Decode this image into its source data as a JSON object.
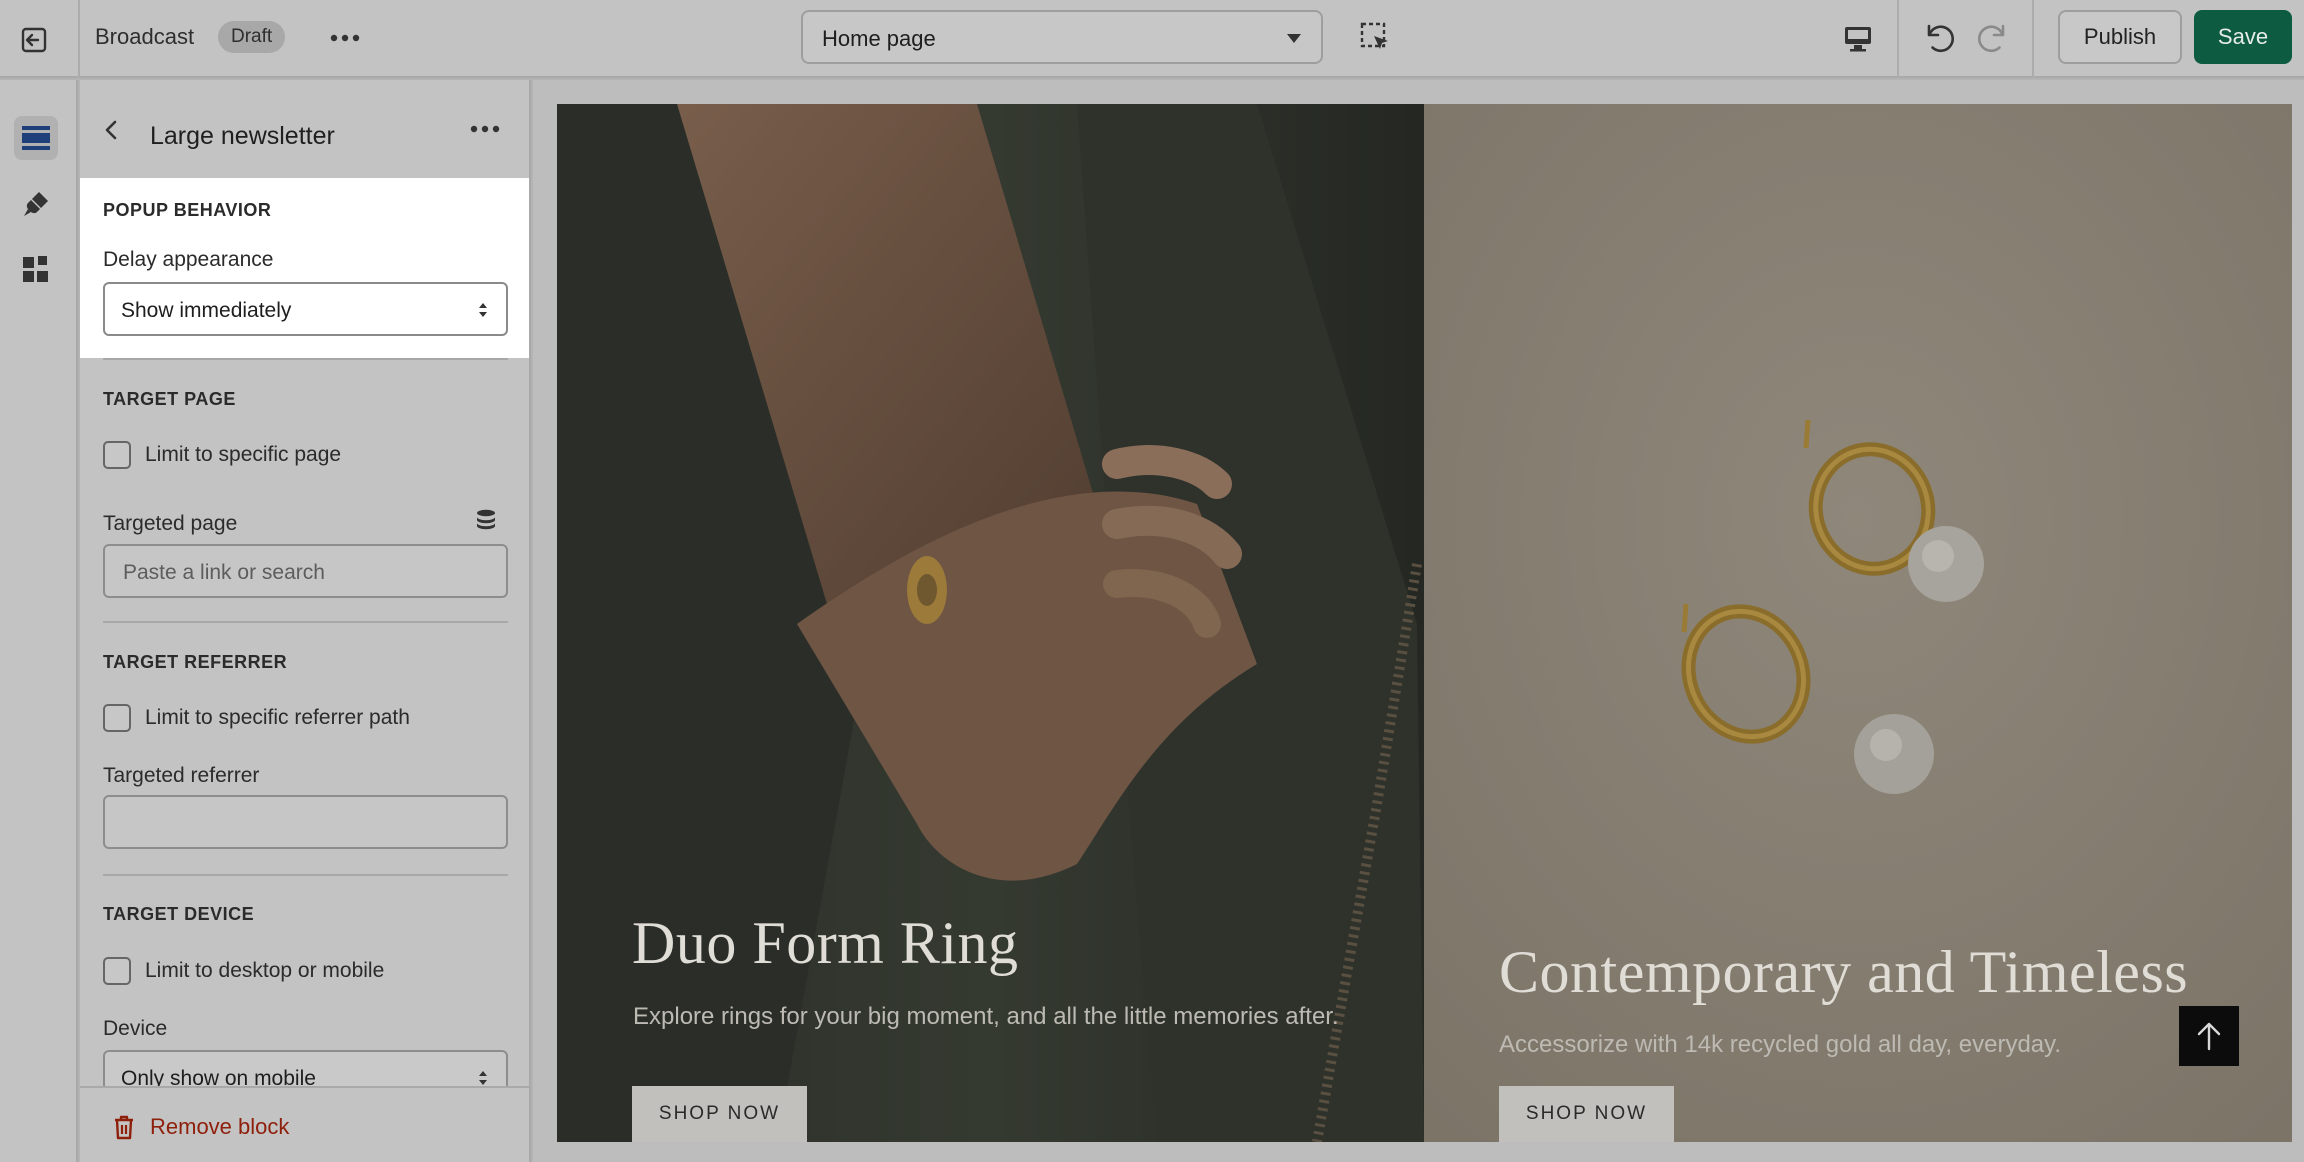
{
  "topbar": {
    "theme_name": "Broadcast",
    "status_badge": "Draft",
    "page_selector": "Home page",
    "publish_label": "Publish",
    "save_label": "Save",
    "accent_color": "#0d5b40"
  },
  "rail": {
    "icons": [
      "sections-icon",
      "theme-settings-brush-icon",
      "apps-icon"
    ]
  },
  "panel": {
    "title": "Large newsletter",
    "popup_behavior": {
      "heading": "POPUP BEHAVIOR",
      "delay_label": "Delay appearance",
      "delay_value": "Show immediately"
    },
    "target_page": {
      "heading": "TARGET PAGE",
      "checkbox_label": "Limit to specific page",
      "field_label": "Targeted page",
      "field_placeholder": "Paste a link or search"
    },
    "target_referrer": {
      "heading": "TARGET REFERRER",
      "checkbox_label": "Limit to specific referrer path",
      "field_label": "Targeted referrer",
      "field_value": ""
    },
    "target_device": {
      "heading": "TARGET DEVICE",
      "checkbox_label": "Limit to desktop or mobile",
      "device_label": "Device",
      "device_value": "Only show on mobile"
    },
    "remove_label": "Remove block",
    "remove_color": "#8e1f0b"
  },
  "preview": {
    "left": {
      "title": "Duo Form Ring",
      "subtitle": "Explore rings for your big moment, and all the little memories after.",
      "button": "SHOP NOW"
    },
    "right": {
      "title": "Contemporary and Timeless",
      "subtitle": "Accessorize with 14k recycled gold all day, everyday.",
      "button": "SHOP NOW"
    }
  }
}
